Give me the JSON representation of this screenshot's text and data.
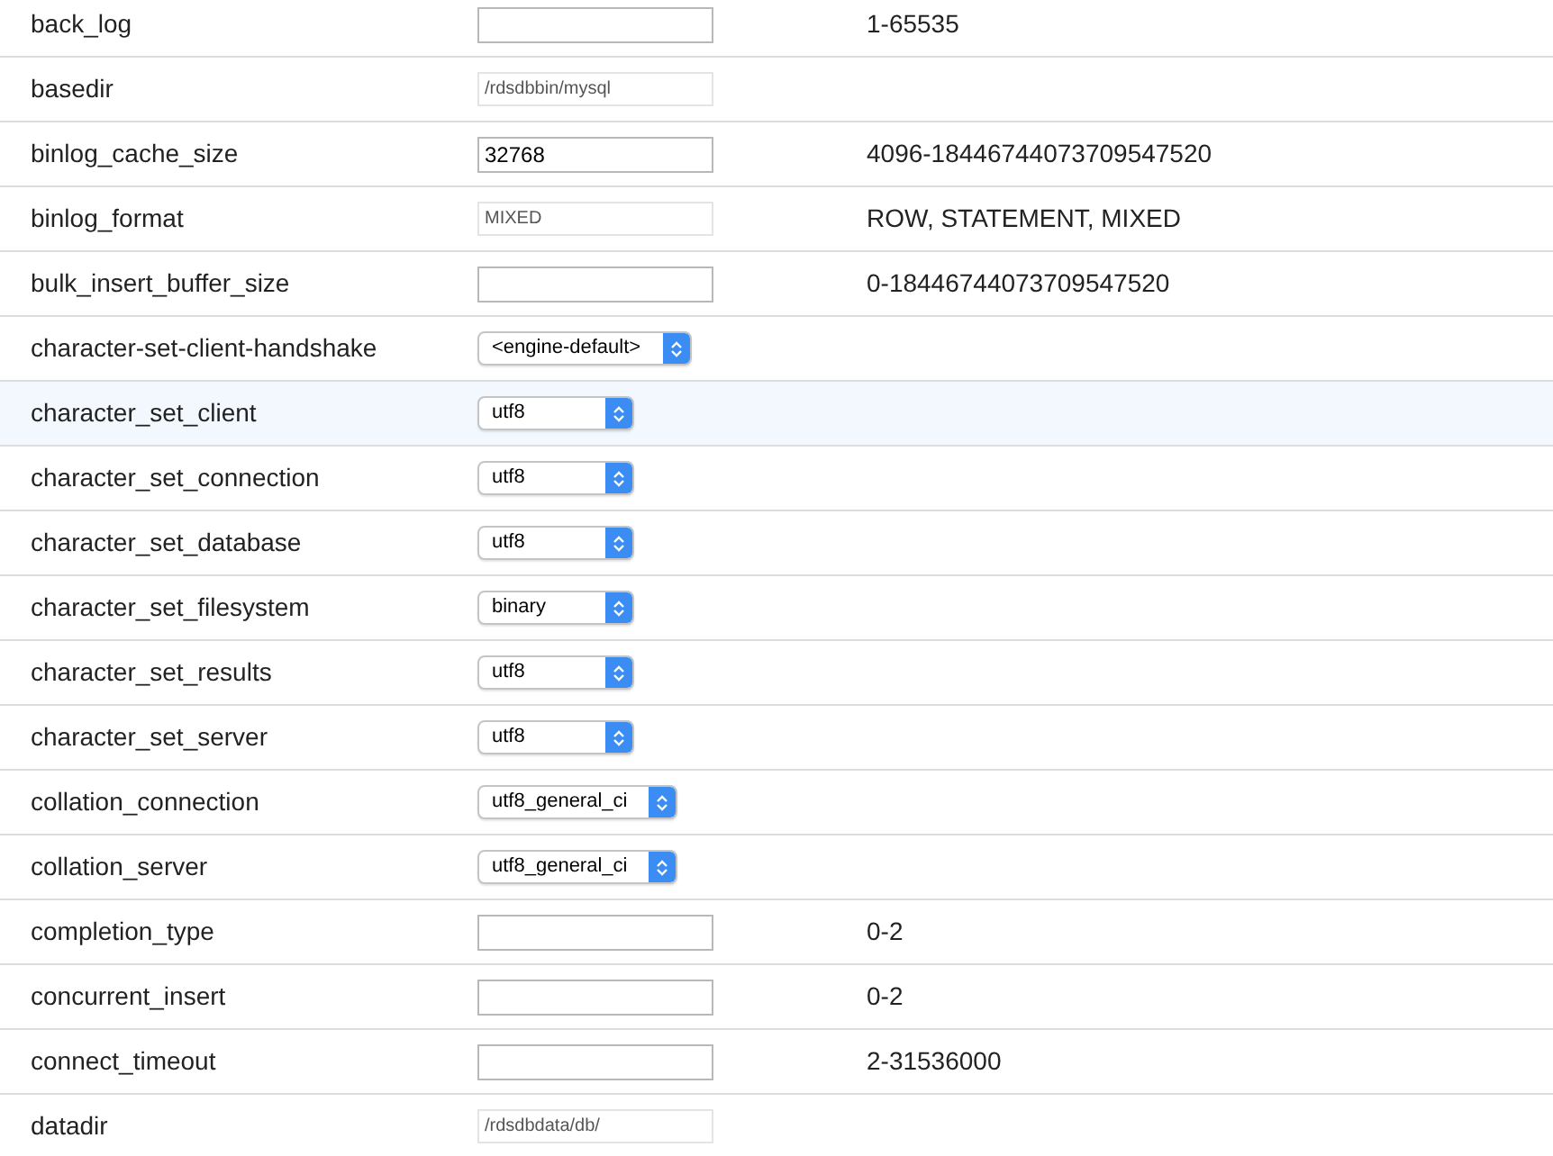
{
  "parameters": [
    {
      "name": "back_log",
      "kind": "input",
      "disabled": false,
      "range": "1-65535",
      "selected": false
    },
    {
      "name": "basedir",
      "kind": "input",
      "disabled": true,
      "value": "/rdsdbbin/mysql",
      "selected": false
    },
    {
      "name": "binlog_cache_size",
      "kind": "input",
      "disabled": false,
      "value": "32768",
      "range": "4096-18446744073709547520",
      "selected": false
    },
    {
      "name": "binlog_format",
      "kind": "input",
      "disabled": true,
      "value": "MIXED",
      "range": "ROW, STATEMENT, MIXED",
      "selected": false
    },
    {
      "name": "bulk_insert_buffer_size",
      "kind": "input",
      "disabled": false,
      "range": "0-18446744073709547520",
      "selected": false
    },
    {
      "name": "character-set-client-handshake",
      "kind": "select",
      "value": "<engine-default>",
      "selected": false
    },
    {
      "name": "character_set_client",
      "kind": "select",
      "value": "utf8",
      "selected": true
    },
    {
      "name": "character_set_connection",
      "kind": "select",
      "value": "utf8",
      "selected": false
    },
    {
      "name": "character_set_database",
      "kind": "select",
      "value": "utf8",
      "selected": false
    },
    {
      "name": "character_set_filesystem",
      "kind": "select",
      "value": "binary",
      "selected": false
    },
    {
      "name": "character_set_results",
      "kind": "select",
      "value": "utf8",
      "selected": false
    },
    {
      "name": "character_set_server",
      "kind": "select",
      "value": "utf8",
      "selected": false
    },
    {
      "name": "collation_connection",
      "kind": "select",
      "value": "utf8_general_ci",
      "selected": false
    },
    {
      "name": "collation_server",
      "kind": "select",
      "value": "utf8_general_ci",
      "selected": false
    },
    {
      "name": "completion_type",
      "kind": "input",
      "disabled": false,
      "range": "0-2",
      "selected": false
    },
    {
      "name": "concurrent_insert",
      "kind": "input",
      "disabled": false,
      "range": "0-2",
      "selected": false
    },
    {
      "name": "connect_timeout",
      "kind": "input",
      "disabled": false,
      "range": "2-31536000",
      "selected": false
    },
    {
      "name": "datadir",
      "kind": "input",
      "disabled": true,
      "value": "/rdsdbdata/db/",
      "selected": false
    }
  ]
}
